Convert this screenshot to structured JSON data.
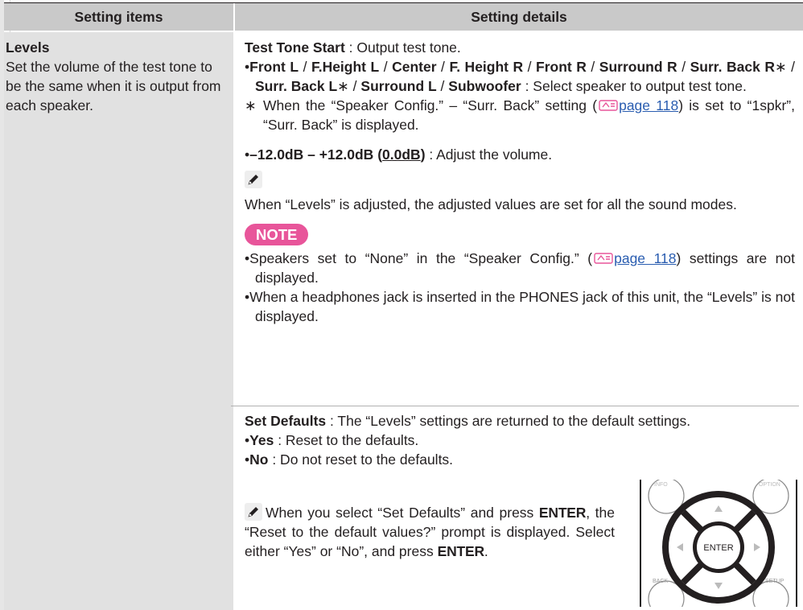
{
  "header": {
    "left": "Setting items",
    "right": "Setting details"
  },
  "item": {
    "title": "Levels",
    "description": "Set the volume of the test tone to be the same when it is output from each speaker."
  },
  "test_tone": {
    "label": "Test Tone Start",
    "text": " : Output test tone.",
    "speakers": [
      "Front L",
      "F.Height L",
      "Center",
      "F. Height R",
      "Front R",
      "Surround R",
      "Surr. Back R",
      "Surr. Back L",
      "Surround L",
      "Subwoofer"
    ],
    "speakers_text": " : Select speaker to output test tone.",
    "asterisk_note_1": "When the “Speaker Config.” – “Surr. Back” setting (",
    "asterisk_note_2": ") is set to “1spkr”, “Surr. Back” is displayed.",
    "page_link": "page 118"
  },
  "volume": {
    "range_label": "–12.0dB – +12.0dB",
    "default": "0.0dB",
    "text": " : Adjust the volume."
  },
  "memo_text": "When “Levels” is adjusted, the adjusted values are set for all the sound modes.",
  "note": {
    "label": "NOTE",
    "bullet1_a": "Speakers set to “None” in the “Speaker Config.” (",
    "bullet1_link": "page 118",
    "bullet1_b": ") settings are not displayed.",
    "bullet2": "When a headphones jack is inserted in the PHONES jack of this unit, the “Levels” is not displayed."
  },
  "defaults": {
    "label": "Set Defaults",
    "text": " : The “Levels” settings are returned to the default settings.",
    "yes_label": "Yes",
    "yes_text": " : Reset to the defaults.",
    "no_label": "No",
    "no_text": " : Do not reset to the defaults.",
    "tip_1": "When you select “Set Defaults” and press ",
    "tip_enter": "ENTER",
    "tip_2": ", the “Reset to the default values?” prompt is displayed. Select either “Yes” or “No”, and press ",
    "tip_3": "."
  },
  "remote": {
    "enter_label": "ENTER",
    "back_label": "BACK",
    "setup_label": "SETUP",
    "top_left_label": "INFO",
    "top_right_label": "OPTION"
  },
  "colors": {
    "header_bg": "#c9c9c9",
    "left_col_bg": "#e1e1e1",
    "note_badge": "#e8559a",
    "link": "#2a5db0"
  },
  "icons": {
    "memo": "pencil-icon",
    "reference": "page-reference-icon"
  }
}
